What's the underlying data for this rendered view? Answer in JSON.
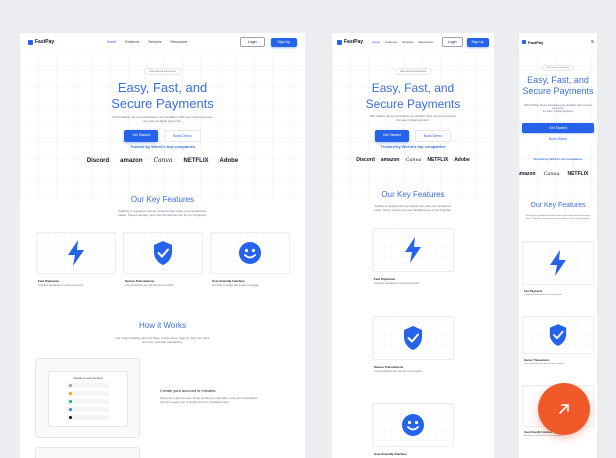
{
  "brand": {
    "name": "FastPay"
  },
  "nav": {
    "links": [
      "Home",
      "Features",
      "Services",
      "Resources"
    ],
    "login": "Login",
    "signup": "Sign Up"
  },
  "hero": {
    "pill": "Fast Secure Payments",
    "title_line1": "Easy, Fast, and",
    "title_line2": "Secure Payments",
    "subtitle_line1": "With FastPay, all your transactions are simplified. Start now and experience",
    "subtitle_line2": "the ease of digital payments.",
    "cta_primary": "Get Started",
    "cta_secondary": "Book Demo"
  },
  "trusted": {
    "label": "Trusted by World's top companies",
    "brands": [
      "Discord",
      "amazon",
      "Canva",
      "NETFLIX",
      "Adobe"
    ]
  },
  "features": {
    "title": "Our Key Features",
    "subtitle_line1": "FastPay is equipped with key features that make your transactions",
    "subtitle_line2": "easier. Speed, security, and user-friendliness are at your fingertips.",
    "items": [
      {
        "title": "Fast Payments",
        "desc": "Complete transactions in just few seconds.",
        "icon": "lightning-icon"
      },
      {
        "title": "Secure Transactions",
        "desc": "Your transactions are safe with our encryption.",
        "icon": "shield-check-icon"
      },
      {
        "title": "User-Friendly Interface",
        "desc": "An intuitive interface that is easy to navigate.",
        "icon": "smiley-icon"
      }
    ]
  },
  "how": {
    "title": "How it Works",
    "subtitle_line1": "Get ready FastPay with just three simple steps. Sign up, link your bank",
    "subtitle_line2": "account, and start transacting.",
    "mock_title": "Create a new Account",
    "step1_title": "Create your account in minutes.",
    "step1_desc_line1": "Signing up is quick and easy. Simply provide your information, verify your email address,",
    "step1_desc_line2": "and you're ready to go. No lengthy forms or complicated steps."
  },
  "colors": {
    "accent": "#2563eb",
    "title": "#3b6fd8",
    "fab": "#f05a2a"
  },
  "fab": {
    "icon": "arrow-up-right-icon"
  }
}
